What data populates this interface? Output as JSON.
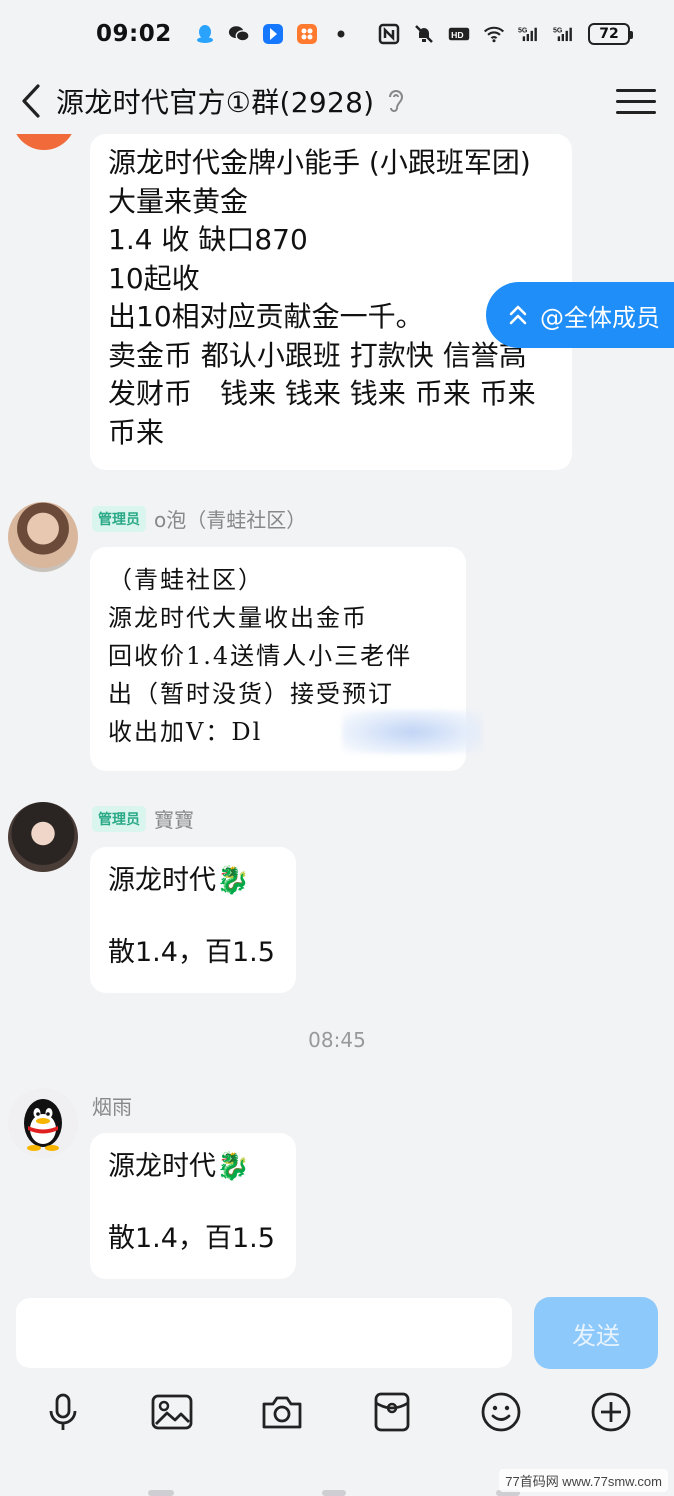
{
  "status_bar": {
    "time": "09:02",
    "battery": "72",
    "app_icons": [
      "qq-icon",
      "wechat-icon",
      "bluetooth-app-icon",
      "app-grid-icon",
      "dot-icon"
    ],
    "sys_icons": [
      "nfc-icon",
      "mute-icon",
      "hd-icon",
      "wifi-icon",
      "signal-5g-icon",
      "signal-5g-icon"
    ]
  },
  "header": {
    "title": "源龙时代官方①群(2928)"
  },
  "at_all": {
    "label": "@全体成员"
  },
  "messages": [
    {
      "lines": [
        "源龙时代金牌小能手 (小跟班军团)",
        "大量来黄金",
        "1.4 收 缺口870",
        "10起收",
        "出10相对应贡献金一千。",
        "卖金币 都认小跟班 打款快 信誉高",
        "发财币　钱来 钱来 钱来 币来 币来",
        "币来"
      ]
    },
    {
      "badge": "管理员",
      "sender": "o泡（青蛙社区）",
      "lines": [
        "（青蛙社区）",
        "源龙时代大量收出金币",
        "回收价1.4送情人小三老伴",
        "出（暂时没货）接受预订",
        "收出加V：Dl"
      ]
    },
    {
      "badge": "管理员",
      "sender": "寶寶",
      "lines": [
        "源龙时代🐉",
        "",
        "散1.4，百1.5"
      ]
    },
    {
      "sender": "烟雨",
      "lines": [
        "源龙时代🐉",
        "",
        "散1.4，百1.5"
      ]
    }
  ],
  "timestamp": "08:45",
  "input": {
    "value": "",
    "send_label": "发送"
  },
  "toolbar": [
    "microphone-icon",
    "image-icon",
    "camera-icon",
    "red-packet-icon",
    "emoji-icon",
    "plus-icon"
  ],
  "watermark": "77首码网 www.77smw.com"
}
